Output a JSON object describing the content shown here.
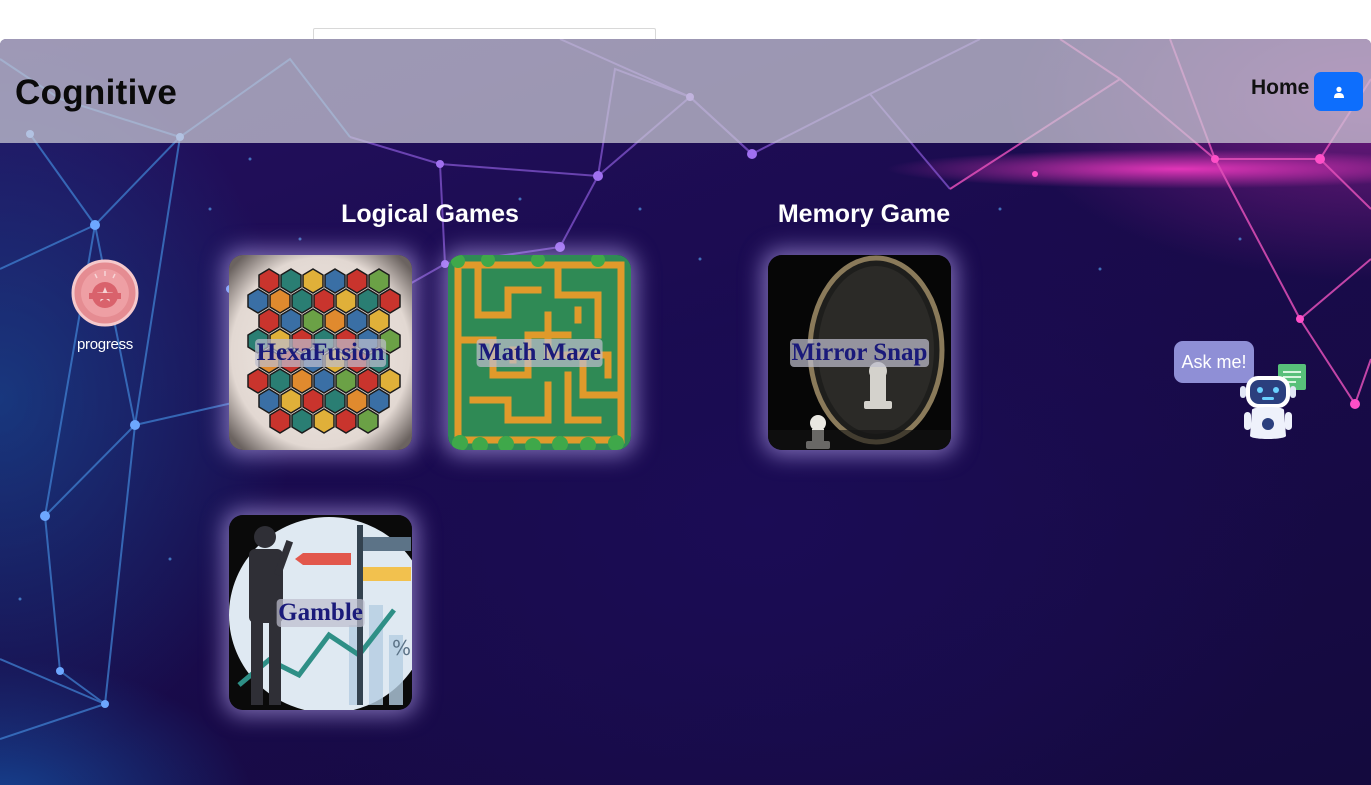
{
  "browser": {
    "address_placeholder": ""
  },
  "navbar": {
    "brand": "Cognitive",
    "home_label": "Home",
    "profile_icon": "user-icon"
  },
  "progress": {
    "label": "progress",
    "icon": "medal-badge-icon"
  },
  "sections": [
    {
      "title": "Logical Games"
    },
    {
      "title": "Memory Game"
    }
  ],
  "games": [
    {
      "name": "HexaFusion",
      "section": "Logical Games",
      "artwork": "hexagon-tiles"
    },
    {
      "name": "Math Maze",
      "section": "Logical Games",
      "artwork": "maze"
    },
    {
      "name": "Gamble",
      "section": "Logical Games",
      "artwork": "businessman-chart"
    },
    {
      "name": "Mirror Snap",
      "section": "Memory Game",
      "artwork": "chess-mirror"
    }
  ],
  "chatbot": {
    "prompt": "Ask me!",
    "icon": "robot-chat-icon"
  },
  "colors": {
    "accent": "#0d6efd",
    "card_label": "#1a1a7a",
    "ask_bubble": "#8f8fd6"
  }
}
